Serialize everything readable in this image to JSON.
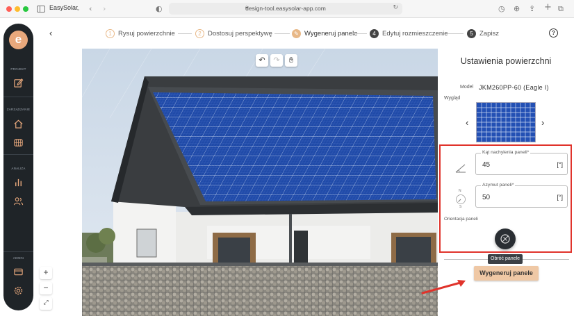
{
  "browser": {
    "app_name": "EasySolar",
    "url": "design-tool.easysolar-app.com"
  },
  "sidebar": {
    "sections": [
      {
        "label": "PROJEKT"
      },
      {
        "label": "ZARZĄDZANIE"
      },
      {
        "label": "ANALIZA"
      },
      {
        "label": "ADMIN"
      }
    ],
    "icons": [
      "edit-icon",
      "home-icon",
      "globe-icon",
      "bar-chart-icon",
      "users-icon",
      "card-icon",
      "gear-icon"
    ]
  },
  "stepper": {
    "steps": [
      {
        "num": "1",
        "label": "Rysuj powierzchnie"
      },
      {
        "num": "2",
        "label": "Dostosuj perspektywę"
      },
      {
        "num": "",
        "label": "Wygeneruj panele"
      },
      {
        "num": "4",
        "label": "Edytuj rozmieszczenie"
      },
      {
        "num": "5",
        "label": "Zapisz"
      }
    ],
    "help": "?"
  },
  "canvas": {
    "tools": [
      "undo-icon",
      "redo-icon",
      "hand-icon"
    ],
    "zoom_in": "+",
    "zoom_out": "−"
  },
  "settings": {
    "title": "Ustawienia powierzchni",
    "model_label": "Model",
    "model_value": "JKM260PP-60 (Eagle I)",
    "look_label": "Wygląd",
    "tilt_label": "Kąt nachylenia paneli*",
    "tilt_value": "45",
    "tilt_unit": "[°]",
    "azimuth_label": "Azymut paneli*",
    "azimuth_value": "50",
    "azimuth_unit": "[°]",
    "orientation_label": "Orientacja paneli",
    "rotate_tooltip": "Obróć panele",
    "generate_label": "Wygeneruj panele",
    "compass_n": "N",
    "compass_s": "S"
  },
  "colors": {
    "accent": "#efc8a5",
    "highlight": "#e0332b",
    "sidebar": "#1f2428",
    "panel_blue": "#1f4aa8"
  }
}
